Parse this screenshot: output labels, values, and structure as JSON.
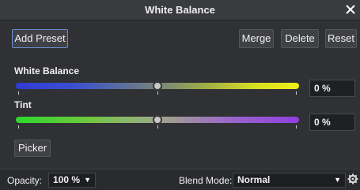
{
  "window": {
    "title": "White Balance"
  },
  "toolbar": {
    "add_preset": "Add Preset",
    "merge": "Merge",
    "delete": "Delete",
    "reset": "Reset"
  },
  "white_balance": {
    "label": "White Balance",
    "value": "0 %",
    "level": 0.5
  },
  "tint": {
    "label": "Tint",
    "value": "0 %",
    "level": 0.5
  },
  "picker": {
    "label": "Picker"
  },
  "bottom": {
    "opacity_label": "Opacity:",
    "opacity_value": "100 %",
    "blend_mode_label": "Blend Mode:",
    "blend_mode_value": "Normal"
  },
  "icons": {
    "close": "close-icon",
    "dropdown": "chevron-down-icon",
    "settings": "gear-icon"
  },
  "colors": {
    "accent_border": "#6a8cd6",
    "panel_bg": "#303134"
  }
}
